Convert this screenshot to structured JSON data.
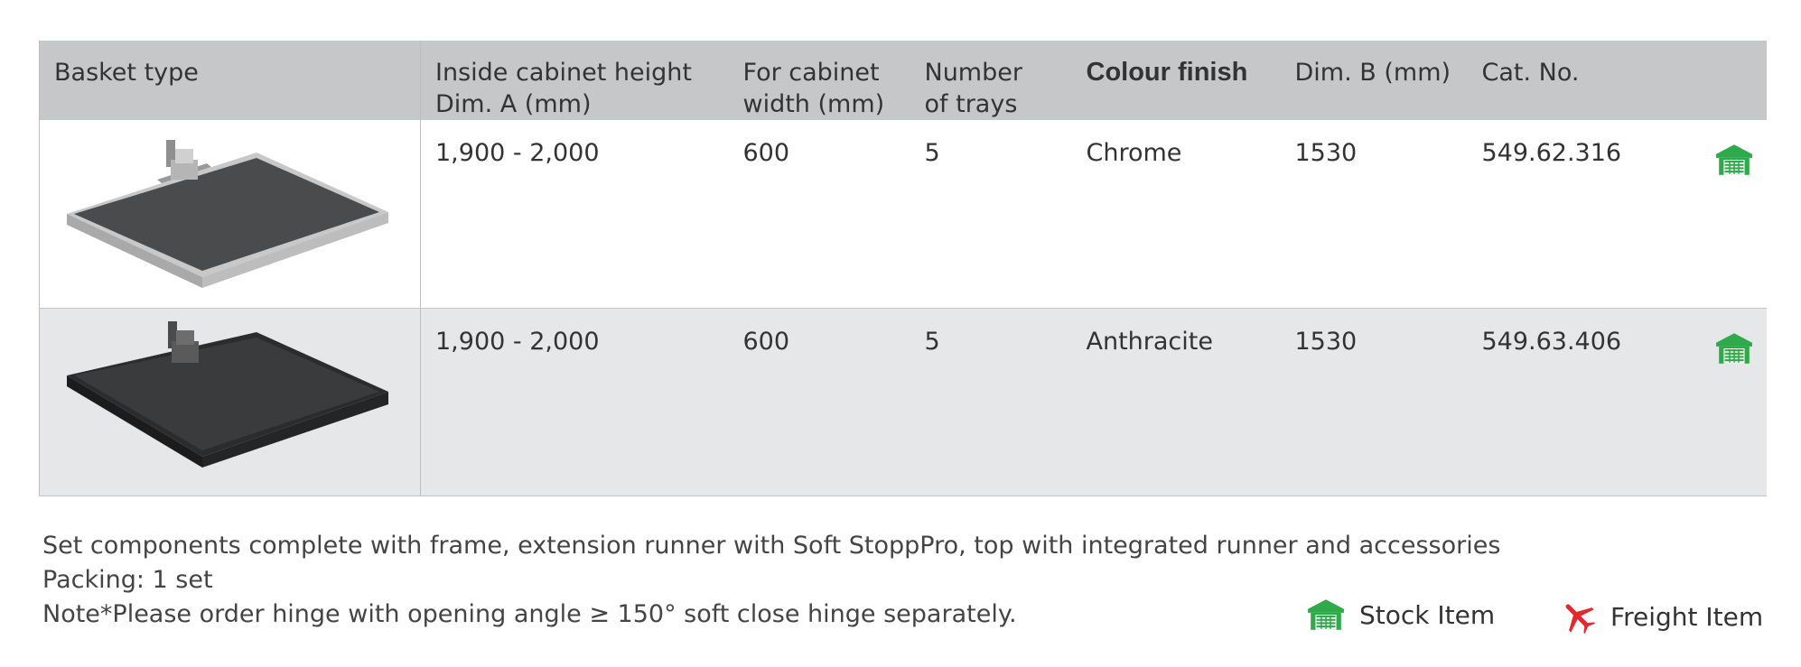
{
  "table": {
    "headers": {
      "basket_type": "Basket type",
      "inside_height": "Inside cabinet height\nDim. A (mm)",
      "cabinet_width": "For cabinet\nwidth (mm)",
      "num_trays": "Number\nof trays",
      "colour_finish": "Colour finish",
      "dim_b": "Dim. B (mm)",
      "cat_no": "Cat. No."
    },
    "rows": [
      {
        "image": "chrome-tray-image",
        "inside_height": "1,900 - 2,000",
        "cabinet_width": "600",
        "num_trays": "5",
        "colour_finish": "Chrome",
        "dim_b": "1530",
        "cat_no": "549.62.316",
        "status_icon": "stock-item-icon"
      },
      {
        "image": "anthracite-tray-image",
        "inside_height": "1,900 - 2,000",
        "cabinet_width": "600",
        "num_trays": "5",
        "colour_finish": "Anthracite",
        "dim_b": "1530",
        "cat_no": "549.63.406",
        "status_icon": "stock-item-icon"
      }
    ]
  },
  "notes": {
    "line1": "Set components complete with frame, extension runner with Soft StoppPro, top with integrated runner and accessories",
    "line2": "Packing: 1 set",
    "line3": "Note*Please order hinge with opening angle ≥ 150° soft close hinge separately."
  },
  "legend": {
    "stock_label": "Stock Item",
    "freight_label": "Freight Item"
  },
  "colors": {
    "header_bg": "#c6c7c9",
    "alt_row_bg": "#e6e7e8",
    "stock_icon": "#2eaa4a",
    "freight_icon": "#e4282e"
  }
}
